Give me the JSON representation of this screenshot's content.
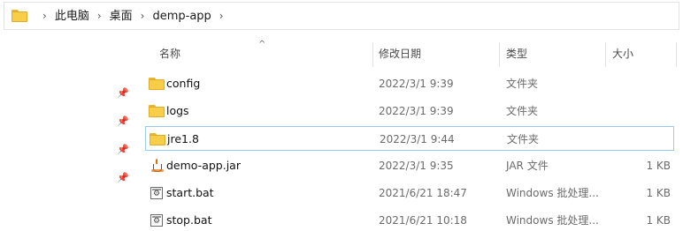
{
  "breadcrumb": {
    "items": [
      "此电脑",
      "桌面",
      "demp-app"
    ],
    "separator": "›"
  },
  "icons": {
    "folder": "folder-icon",
    "pin": "pin-icon",
    "jar": "java-jar-icon",
    "bat": "batch-file-icon",
    "sort": "sort-ascending-icon"
  },
  "columns": {
    "name": "名称",
    "date": "修改日期",
    "type": "类型",
    "size": "大小"
  },
  "files": [
    {
      "name": "config",
      "date": "2022/3/1 9:39",
      "type": "文件夹",
      "size": "",
      "icon": "folder"
    },
    {
      "name": "logs",
      "date": "2022/3/1 9:39",
      "type": "文件夹",
      "size": "",
      "icon": "folder"
    },
    {
      "name": "jre1.8",
      "date": "2022/3/1 9:44",
      "type": "文件夹",
      "size": "",
      "icon": "folder",
      "selected": true
    },
    {
      "name": "demo-app.jar",
      "date": "2022/3/1 9:35",
      "type": "JAR 文件",
      "size": "1 KB",
      "icon": "jar"
    },
    {
      "name": "start.bat",
      "date": "2021/6/21 18:47",
      "type": "Windows 批处理...",
      "size": "1 KB",
      "icon": "bat"
    },
    {
      "name": "stop.bat",
      "date": "2021/6/21 10:18",
      "type": "Windows 批处理...",
      "size": "1 KB",
      "icon": "bat"
    }
  ],
  "colors": {
    "folder": "#f8cd47",
    "selection_border": "#99c9ef",
    "java_orange": "#e76f00"
  }
}
